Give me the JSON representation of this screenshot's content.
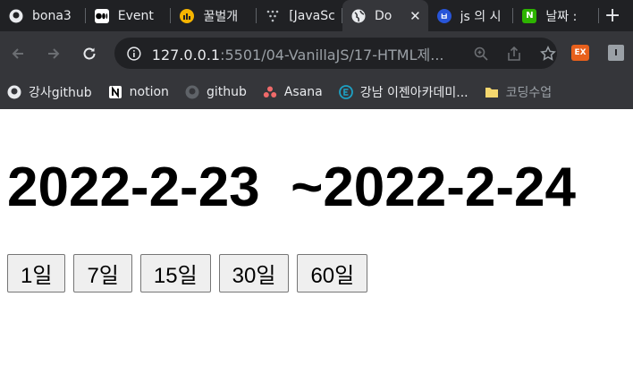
{
  "browser": {
    "tabs": [
      {
        "title": "bona3",
        "icon": "github-icon",
        "active": false
      },
      {
        "title": "Event",
        "icon": "medium-icon",
        "active": false
      },
      {
        "title": "꿀벌개",
        "icon": "bee-icon",
        "active": false
      },
      {
        "title": "[JavaSc",
        "icon": "dots-icon",
        "active": false
      },
      {
        "title": "Do",
        "icon": "globe-icon",
        "active": true
      },
      {
        "title": "js 의 시",
        "icon": "velog-icon",
        "active": false
      },
      {
        "title": "날짜 :",
        "icon": "naver-icon",
        "active": false
      }
    ],
    "close_symbol": "✕",
    "new_tab_symbol": "+",
    "url_host": "127.0.0.1",
    "url_rest": ":5501/04-VanillaJS/17-HTML제...",
    "extensions": {
      "ex_label": "EX",
      "i_label": "I"
    },
    "bookmarks": [
      {
        "label": "강사github",
        "icon": "github-icon"
      },
      {
        "label": "notion",
        "icon": "notion-icon"
      },
      {
        "label": "github",
        "icon": "github-icon"
      },
      {
        "label": "Asana",
        "icon": "asana-icon"
      },
      {
        "label": "강남 이젠아카데미...",
        "icon": "ezen-icon"
      },
      {
        "label": "코딩수업",
        "icon": "folder-icon"
      }
    ]
  },
  "page": {
    "heading": "2022-2-23  ~2022-2-24",
    "buttons": [
      {
        "label": "1일"
      },
      {
        "label": "7일"
      },
      {
        "label": "15일"
      },
      {
        "label": "30일"
      },
      {
        "label": "60일"
      }
    ]
  }
}
